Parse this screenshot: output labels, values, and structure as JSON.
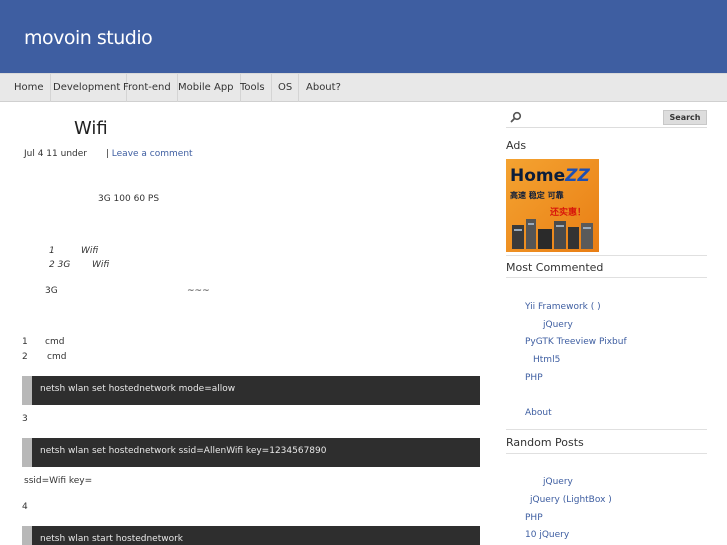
{
  "site": {
    "title": "movoin studio"
  },
  "nav": {
    "items": [
      "Home",
      "Development",
      "Front-end",
      "Mobile App",
      "Tools",
      "OS",
      "About?"
    ]
  },
  "post": {
    "title": "Wifi",
    "meta_date": "Jul 4 11 under",
    "meta_sep": "|",
    "comment_link": "Leave a comment",
    "p1": "3G   100  60   PS",
    "item1_num": "1",
    "item1_text": "Wifi",
    "item2_num": "2  3G",
    "item2_text": "Wifi",
    "p2_a": "3G",
    "p2_b": "~~~",
    "step1_num": "1",
    "step1_text": "cmd",
    "step2_num": "2",
    "step2_text": "cmd",
    "code1": "netsh wlan set hostednetwork mode=allow",
    "step3_num": "3",
    "code2": "netsh wlan set hostednetwork ssid=AllenWifi key=1234567890",
    "note": "ssid=Wifi     key=",
    "step4_num": "4",
    "code3": "netsh wlan start hostednetwork"
  },
  "sidebar": {
    "search": {
      "placeholder": "",
      "button": "Search"
    },
    "ads_title": "Ads",
    "ad": {
      "brand_a": "Home",
      "brand_b": "ZZ",
      "line1": "高速 稳定 可靠",
      "line2": "还实惠！"
    },
    "most_commented_title": "Most Commented",
    "most_commented": [
      "Yii Framework      ( )",
      "jQuery",
      "PyGTK Treeview  Pixbuf",
      "Html5",
      "PHP",
      "About"
    ],
    "random_title": "Random Posts",
    "random_posts": [
      "jQuery",
      "jQuery  (LightBox )",
      "PHP",
      "10   jQuery"
    ]
  }
}
